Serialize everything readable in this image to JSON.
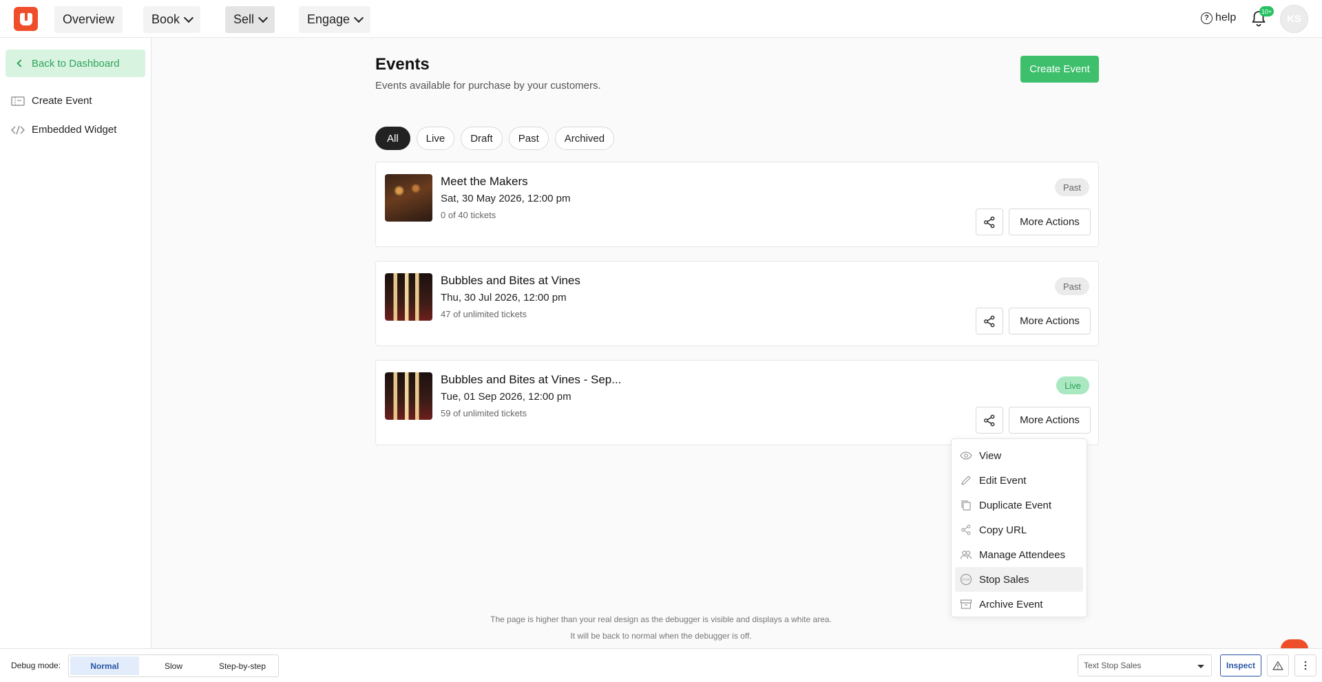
{
  "nav": {
    "overview": "Overview",
    "book": "Book",
    "sell": "Sell",
    "engage": "Engage",
    "help": "help",
    "notif_count": "10+",
    "avatar_initials": "KS"
  },
  "sidebar": {
    "back": "Back to Dashboard",
    "items": [
      {
        "label": "Create Event",
        "icon": "ticket-icon"
      },
      {
        "label": "Embedded Widget",
        "icon": "code-icon"
      }
    ]
  },
  "page": {
    "title": "Events",
    "subtitle": "Events available for purchase by your customers.",
    "create_button": "Create Event"
  },
  "filters": [
    "All",
    "Live",
    "Draft",
    "Past",
    "Archived"
  ],
  "events": [
    {
      "title": "Meet the Makers",
      "date": "Sat, 30 May 2026, 12:00 pm",
      "tickets": "0 of 40 tickets",
      "status": "Past"
    },
    {
      "title": "Bubbles and Bites at Vines",
      "date": "Thu, 30 Jul 2026, 12:00 pm",
      "tickets": "47 of unlimited tickets",
      "status": "Past"
    },
    {
      "title": "Bubbles and Bites at Vines - Sep...",
      "date": "Tue, 01 Sep 2026, 12:00 pm",
      "tickets": "59 of unlimited tickets",
      "status": "Live"
    }
  ],
  "more_actions_label": "More Actions",
  "menu": [
    {
      "label": "View",
      "icon": "eye-icon"
    },
    {
      "label": "Edit Event",
      "icon": "pencil-icon"
    },
    {
      "label": "Duplicate Event",
      "icon": "copy-icon"
    },
    {
      "label": "Copy URL",
      "icon": "share-icon"
    },
    {
      "label": "Manage Attendees",
      "icon": "users-icon"
    },
    {
      "label": "Stop Sales",
      "icon": "stop-icon"
    },
    {
      "label": "Archive Event",
      "icon": "archive-icon"
    }
  ],
  "debug_note": {
    "line1": "The page is higher than your real design as the debugger is visible and displays a white area.",
    "line2": "It will be back to normal when the debugger is off."
  },
  "debugbar": {
    "label": "Debug mode:",
    "modes": [
      "Normal",
      "Slow",
      "Step-by-step"
    ],
    "selected_mode": "Normal",
    "select_value": "Text Stop Sales",
    "inspect": "Inspect"
  },
  "colors": {
    "brand": "#ef4e2b",
    "primary_green": "#3dbf6c",
    "live_badge": "#a9e8c0"
  }
}
